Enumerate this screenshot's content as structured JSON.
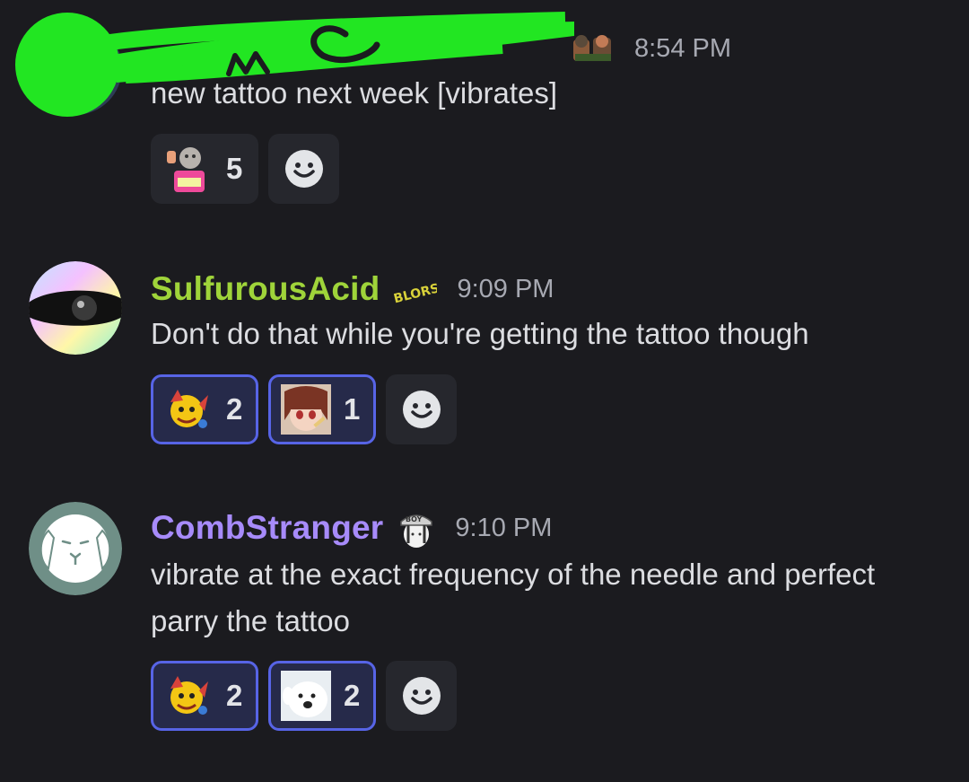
{
  "messages": [
    {
      "username": "",
      "username_color": "#46a05a",
      "timestamp": "8:54 PM",
      "text": "new tattoo next week [vibrates]",
      "redaction_text": "me",
      "reactions": [
        {
          "emoji": "bully-demise-emoji",
          "count": "5",
          "me": false
        }
      ]
    },
    {
      "username": "SulfurousAcid",
      "username_color": "#9fd43a",
      "role_icon": "blorsh-sticker",
      "role_icon_text": "BLORSH",
      "timestamp": "9:09 PM",
      "text": "Don't do that while you're getting the tattoo though",
      "reactions": [
        {
          "emoji": "yellow-clown-emoji",
          "count": "2",
          "me": true
        },
        {
          "emoji": "anime-girl-emoji",
          "count": "1",
          "me": true
        }
      ]
    },
    {
      "username": "CombStranger",
      "username_color": "#a78bfa",
      "role_icon": "boy-cap-icon",
      "role_icon_text": "BOY",
      "timestamp": "9:10 PM",
      "text": "vibrate at the exact frequency of the needle and perfect parry the tattoo",
      "reactions": [
        {
          "emoji": "yellow-clown-emoji",
          "count": "2",
          "me": true
        },
        {
          "emoji": "white-dog-emoji",
          "count": "2",
          "me": true
        }
      ]
    }
  ],
  "colors": {
    "background": "#1b1b1f",
    "accent": "#5764e6",
    "reaction_bg": "#26272d",
    "reaction_me_bg": "#262a4a",
    "redaction": "#22e622"
  }
}
